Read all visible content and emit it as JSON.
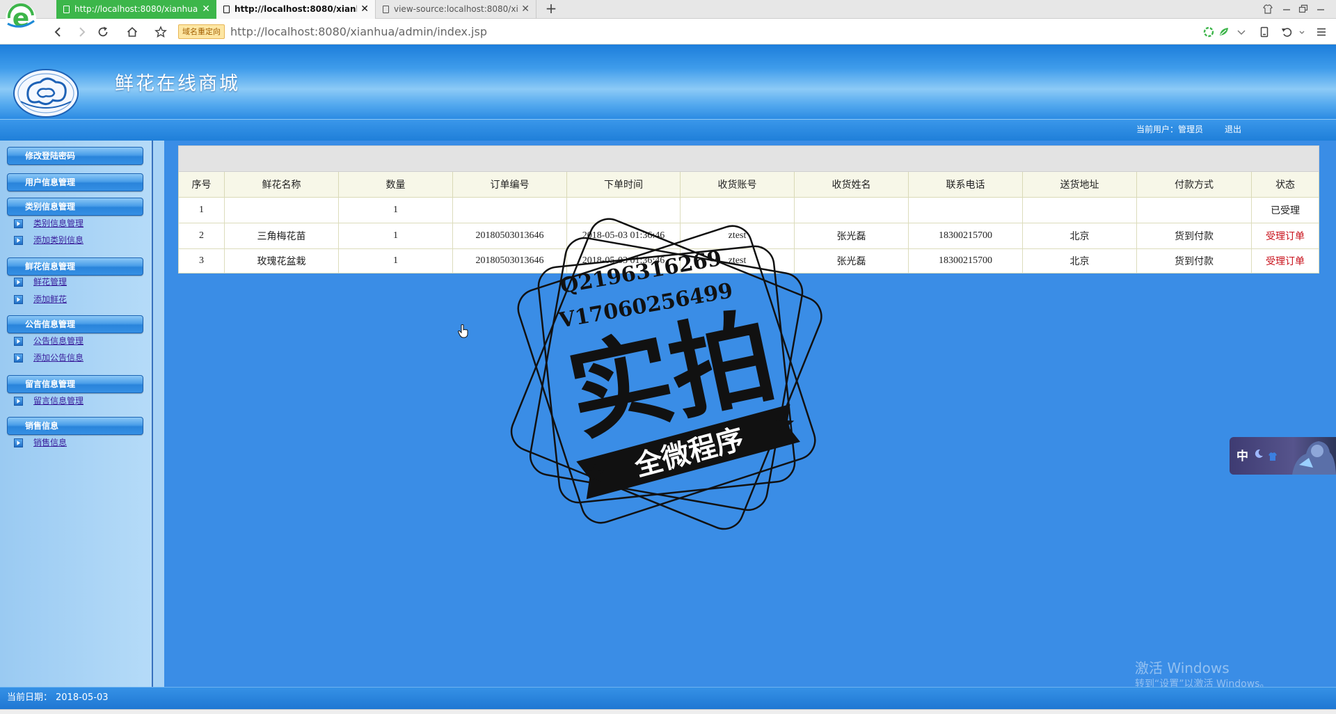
{
  "browser": {
    "tabs": [
      {
        "label": "http://localhost:8080/xianhua",
        "state": "highlighted"
      },
      {
        "label": "http://localhost:8080/xianh",
        "state": "active"
      },
      {
        "label": "view-source:localhost:8080/xi",
        "state": "normal"
      }
    ],
    "tab_close_glyph": "✕",
    "new_tab_glyph": "+",
    "redirect_badge": "域名重定向",
    "url": "http://localhost:8080/xianhua/admin/index.jsp"
  },
  "icons": {
    "toolbar": [
      "back-icon",
      "forward-icon",
      "refresh-icon",
      "home-icon",
      "star-icon"
    ],
    "toolbar_right": [
      "security-icon",
      "speed-icon",
      "chevron-down-icon",
      "bookmark-icon",
      "undo-icon",
      "menu-icon"
    ],
    "window": [
      "skin-icon",
      "minimize-icon",
      "restore-icon",
      "close-icon"
    ]
  },
  "header": {
    "title": "鲜花在线商城"
  },
  "userbar": {
    "current_user": "当前用户：管理员",
    "logout": "退出"
  },
  "sidebar": {
    "groups": [
      {
        "title": "修改登陆密码",
        "items": []
      },
      {
        "title": "用户信息管理",
        "items": []
      },
      {
        "title": "类别信息管理",
        "items": [
          "类别信息管理",
          "添加类别信息"
        ]
      },
      {
        "title": "鲜花信息管理",
        "items": [
          "鲜花管理",
          "添加鲜花"
        ]
      },
      {
        "title": "公告信息管理",
        "items": [
          "公告信息管理",
          "添加公告信息"
        ]
      },
      {
        "title": "留言信息管理",
        "items": [
          "留言信息管理"
        ]
      },
      {
        "title": "销售信息",
        "items": [
          "销售信息"
        ]
      }
    ]
  },
  "table": {
    "columns": [
      "序号",
      "鲜花名称",
      "数量",
      "订单编号",
      "下单时间",
      "收货账号",
      "收货姓名",
      "联系电话",
      "送货地址",
      "付款方式",
      "状态"
    ],
    "rows": [
      [
        "1",
        "",
        "1",
        "",
        "",
        "",
        "",
        "",
        "",
        "",
        "已受理"
      ],
      [
        "2",
        "三角梅花苗",
        "1",
        "20180503013646",
        "2018-05-03 01:36:46",
        "ztest",
        "张光磊",
        "18300215700",
        "北京",
        "货到付款",
        "受理订单"
      ],
      [
        "3",
        "玫瑰花盆栽",
        "1",
        "20180503013646",
        "2018-05-03 01:36:46",
        "ztest",
        "张光磊",
        "18300215700",
        "北京",
        "货到付款",
        "受理订单"
      ]
    ]
  },
  "footer": {
    "date_label": "当前日期：",
    "date": "2018-05-03"
  },
  "ime": {
    "mode": "中"
  },
  "windows_watermark": {
    "line1": "激活 Windows",
    "line2": "转到“设置”以激活 Windows。"
  },
  "stamp": {
    "qq": "Q2196316269",
    "wechat": "V17060256499",
    "title": "实拍",
    "ribbon": "全微程序"
  },
  "colors": {
    "main_bg": "#3a8de6",
    "sidebar_bg": "#a8d3f6",
    "highlight_tab": "#3cb64a",
    "action_link": "#c8101a",
    "nav_link": "#3a1f9c",
    "table_header_bg": "#f7f7e8"
  }
}
